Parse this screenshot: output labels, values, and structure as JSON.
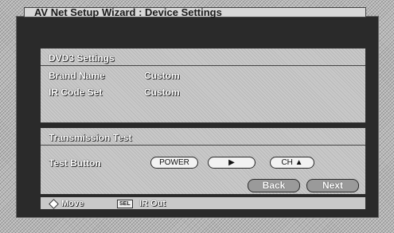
{
  "title": "AV Net Setup Wizard : Device Settings",
  "settings": {
    "heading": "DVD3 Settings",
    "brand_label": "Brand Name",
    "brand_value": "Custom",
    "ircode_label": "IR Code Set",
    "ircode_value": "Custom"
  },
  "test": {
    "heading": "Transmission Test",
    "test_label": "Test Button",
    "power_label": "POWER",
    "play_label": "▶",
    "ch_label": "CH ▲",
    "back_label": "Back",
    "next_label": "Next"
  },
  "footer": {
    "move_label": "Move",
    "sel_label": "SEL",
    "irout_label": "IR Out"
  }
}
